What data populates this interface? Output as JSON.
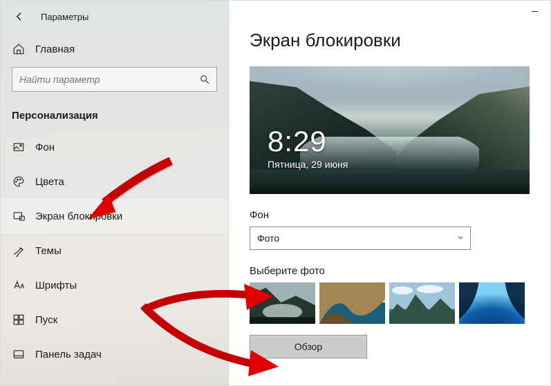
{
  "window": {
    "title": "Параметры"
  },
  "sidebar": {
    "home_label": "Главная",
    "search_placeholder": "Найти параметр",
    "section_header": "Персонализация",
    "items": [
      {
        "label": "Фон"
      },
      {
        "label": "Цвета"
      },
      {
        "label": "Экран блокировки"
      },
      {
        "label": "Темы"
      },
      {
        "label": "Шрифты"
      },
      {
        "label": "Пуск"
      },
      {
        "label": "Панель задач"
      }
    ]
  },
  "main": {
    "page_title": "Экран блокировки",
    "preview": {
      "time": "8:29",
      "date": "Пятница, 29 июня"
    },
    "background_label": "Фон",
    "background_value": "Фото",
    "choose_photo_label": "Выберите фото",
    "browse_label": "Обзор"
  }
}
